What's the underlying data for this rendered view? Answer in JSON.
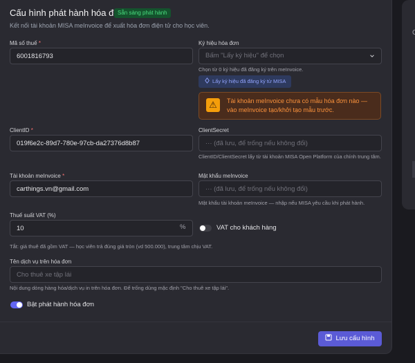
{
  "header": {
    "title": "Cấu hình phát hành hóa đơn",
    "status_badge": "Sẵn sàng phát hành",
    "subtitle": "Kết nối tài khoản MISA meInvoice để xuất hóa đơn điện tử cho học viên."
  },
  "tax_code": {
    "label": "Mã số thuế",
    "value": "6001816793"
  },
  "invoice_symbol": {
    "label": "Ký hiệu hóa đơn",
    "placeholder": "Bấm \"Lấy ký hiệu\" để chọn",
    "helper": "Chọn từ 0 ký hiệu đã đăng ký trên meInvoice.",
    "fetch_button": "Lấy ký hiệu đã đăng ký từ MISA"
  },
  "warning": {
    "text": "Tài khoản meInvoice chưa có mẫu hóa đơn nào — vào meInvoice tạo/khởi tạo mẫu trước."
  },
  "client_id": {
    "label": "ClientID",
    "value": "019f6e2c-89d7-780e-97cb-da27376d8b87"
  },
  "client_secret": {
    "label": "ClientSecret",
    "placeholder": "··· (đã lưu, để trống nếu không đổi)",
    "helper": "ClientID/ClientSecret lấy từ tài khoản MISA Open Platform của chính trung tâm."
  },
  "account": {
    "label": "Tài khoản meInvoice",
    "value": "carthings.vn@gmail.com"
  },
  "password": {
    "label": "Mật khẩu meInvoice",
    "placeholder": "··· (đã lưu, để trống nếu không đổi)",
    "helper": "Mật khẩu tài khoản meInvoice — nhập nếu MISA yêu cầu khi phát hành."
  },
  "vat": {
    "label": "Thuế suất VAT (%)",
    "value": "10",
    "unit": "%",
    "customer_toggle_label": "VAT cho khách hàng",
    "customer_toggle_on": false,
    "helper": "Tắt: giá thuê đã gồm VAT — học viên trả đúng giá tròn (vd 500.000), trung tâm chịu VAT."
  },
  "service_name": {
    "label": "Tên dịch vụ trên hóa đơn",
    "placeholder": "Cho thuê xe tập lái",
    "helper": "Nội dung dòng hàng hóa/dịch vụ in trên hóa đơn. Để trống dùng mặc định \"Cho thuê xe tập lái\"."
  },
  "enable_toggle": {
    "label": "Bật phát hành hóa đơn",
    "on": true
  },
  "save_button": {
    "label": "Lưu cấu hình"
  },
  "side_panel": {
    "text": "Cl"
  },
  "colors": {
    "accent": "#5b5bd6",
    "success": "#4ade80",
    "warning": "#fb923c",
    "required": "#f87171"
  }
}
